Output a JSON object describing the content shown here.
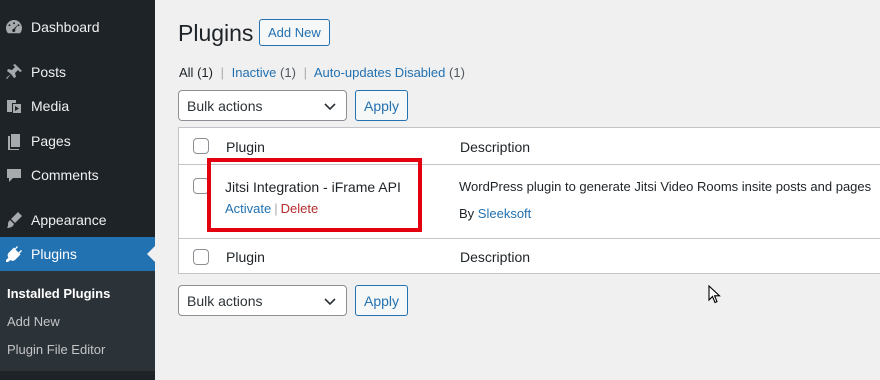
{
  "sidebar": {
    "items": [
      {
        "label": "Dashboard",
        "icon": "dashboard-icon"
      },
      {
        "label": "Posts",
        "icon": "pushpin-icon"
      },
      {
        "label": "Media",
        "icon": "media-icon"
      },
      {
        "label": "Pages",
        "icon": "pages-icon"
      },
      {
        "label": "Comments",
        "icon": "comment-icon"
      },
      {
        "label": "Appearance",
        "icon": "paintbrush-icon"
      },
      {
        "label": "Plugins",
        "icon": "plugin-icon"
      }
    ],
    "submenu": [
      "Installed Plugins",
      "Add New",
      "Plugin File Editor"
    ]
  },
  "header": {
    "title": "Plugins",
    "add_new": "Add New"
  },
  "filters": [
    {
      "label": "All",
      "count": "(1)"
    },
    {
      "label": "Inactive",
      "count": "(1)"
    },
    {
      "label": "Auto-updates Disabled",
      "count": "(1)"
    }
  ],
  "bulk": {
    "select_label": "Bulk actions",
    "apply_label": "Apply"
  },
  "table": {
    "columns": [
      "Plugin",
      "Description"
    ],
    "rows": [
      {
        "name": "Jitsi Integration - iFrame API",
        "actions": [
          "Activate",
          "Delete"
        ],
        "description": "WordPress plugin to generate Jitsi Video Rooms insite posts and pages",
        "by_prefix": "By",
        "author": "Sleeksoft"
      }
    ]
  },
  "colors": {
    "sidebar_bg": "#1d2327",
    "accent": "#2271b1",
    "delete": "#b32d2e",
    "highlight": "#e3000f"
  }
}
